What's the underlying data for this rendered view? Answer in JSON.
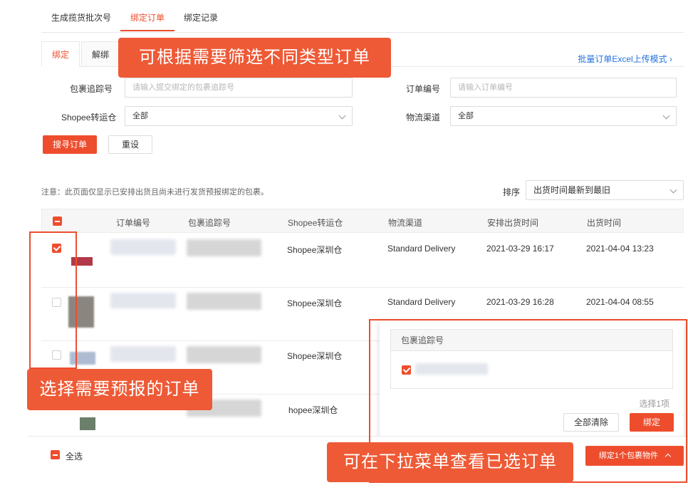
{
  "top_tabs": [
    "生成揽货批次号",
    "绑定订单",
    "绑定记录"
  ],
  "sub_tabs": [
    "绑定",
    "解绑"
  ],
  "excel_link": "批量订单Excel上传模式 ›",
  "form": {
    "tracking_label": "包裹追踪号",
    "tracking_placeholder": "请输入提交绑定的包裹追踪号",
    "order_label": "订单编号",
    "order_placeholder": "请输入订单编号",
    "warehouse_label": "Shopee转运仓",
    "warehouse_value": "全部",
    "channel_label": "物流渠道",
    "channel_value": "全部",
    "search_button": "搜寻订单",
    "reset_button": "重设"
  },
  "note": "注意：此页面仅显示已安排出货且尚未进行发货预报绑定的包裹。",
  "sort": {
    "label": "排序",
    "value": "出货时间最新到最旧"
  },
  "table": {
    "headers": [
      "订单编号",
      "包裹追踪号",
      "Shopee转运仓",
      "物流渠道",
      "安排出货时间",
      "出货时间"
    ],
    "rows": [
      {
        "checked": true,
        "warehouse": "Shopee深圳仓",
        "channel": "Standard Delivery",
        "arranged": "2021-03-29 16:17",
        "shipped": "2021-04-04 13:23"
      },
      {
        "checked": false,
        "warehouse": "Shopee深圳仓",
        "channel": "Standard Delivery",
        "arranged": "2021-03-29 16:28",
        "shipped": "2021-04-04 08:55"
      },
      {
        "checked": false,
        "warehouse": "Shopee深圳仓",
        "channel": "",
        "arranged": "",
        "shipped": ""
      },
      {
        "checked": false,
        "warehouse": "hopee深圳仓",
        "channel": "",
        "arranged": "",
        "shipped": ""
      }
    ]
  },
  "panel": {
    "header": "包裹追踪号",
    "selected_count": "选择1项",
    "clear_button": "全部清除",
    "bind_button": "绑定"
  },
  "bottom": {
    "select_all": "全选",
    "bind_button": "绑定1个包裹物件"
  },
  "callouts": {
    "filter": "可根据需要筛选不同类型订单",
    "select": "选择需要预报的订单",
    "dropdown": "可在下拉菜单查看已选订单"
  },
  "colors": {
    "accent": "#ee4d2d",
    "link": "#2673dd",
    "callout": "#ee5a36"
  }
}
